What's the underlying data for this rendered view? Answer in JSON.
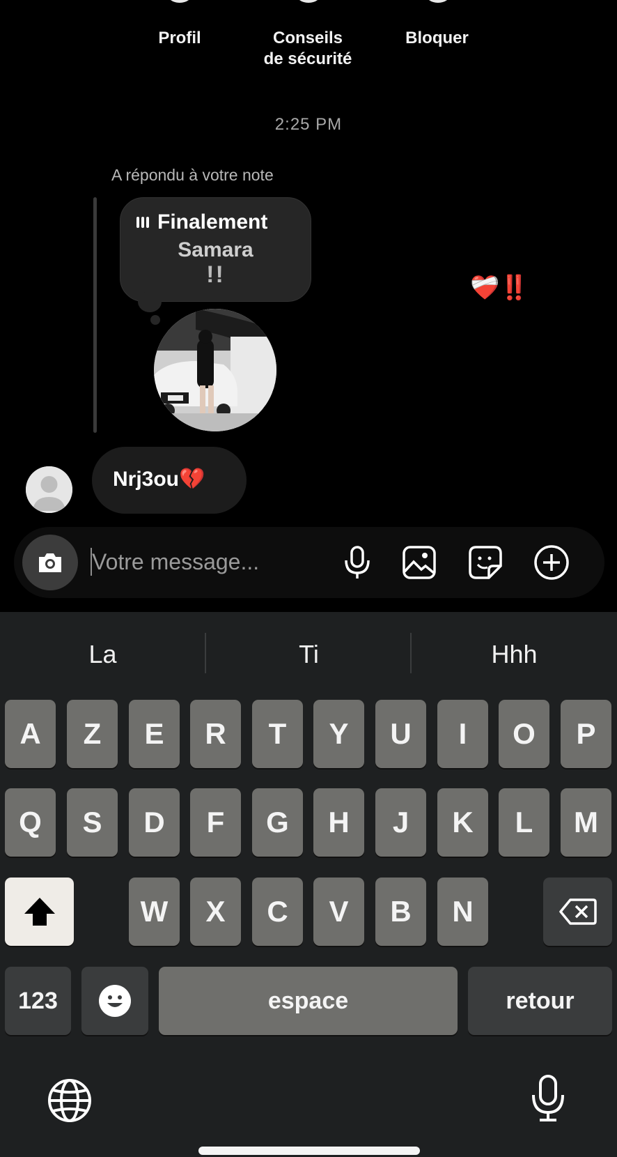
{
  "header_actions": {
    "profil": "Profil",
    "conseils_line1": "Conseils",
    "conseils_line2": "de sécurité",
    "bloquer": "Bloquer"
  },
  "thread": {
    "timestamp": "2:25 PM",
    "reply_label": "A répondu à votre note",
    "note": {
      "title": "Finalement",
      "subtitle": "Samara",
      "extra": "!!"
    },
    "reaction": "❤️‍🩹‼️",
    "incoming_message": "Nrj3ou💔"
  },
  "composer": {
    "placeholder": "Votre message..."
  },
  "keyboard": {
    "suggestions": [
      "La",
      "Ti",
      "Hhh"
    ],
    "row1": [
      "A",
      "Z",
      "E",
      "R",
      "T",
      "Y",
      "U",
      "I",
      "O",
      "P"
    ],
    "row2": [
      "Q",
      "S",
      "D",
      "F",
      "G",
      "H",
      "J",
      "K",
      "L",
      "M"
    ],
    "row3": [
      "W",
      "X",
      "C",
      "V",
      "B",
      "N"
    ],
    "numbers_label": "123",
    "space_label": "espace",
    "return_label": "retour"
  },
  "colors": {
    "background": "#000000",
    "keyboard_bg": "#1e2021",
    "key_light": "#6f6f6c",
    "key_dark": "#3a3c3d",
    "reaction_red": "#e00d1c"
  }
}
